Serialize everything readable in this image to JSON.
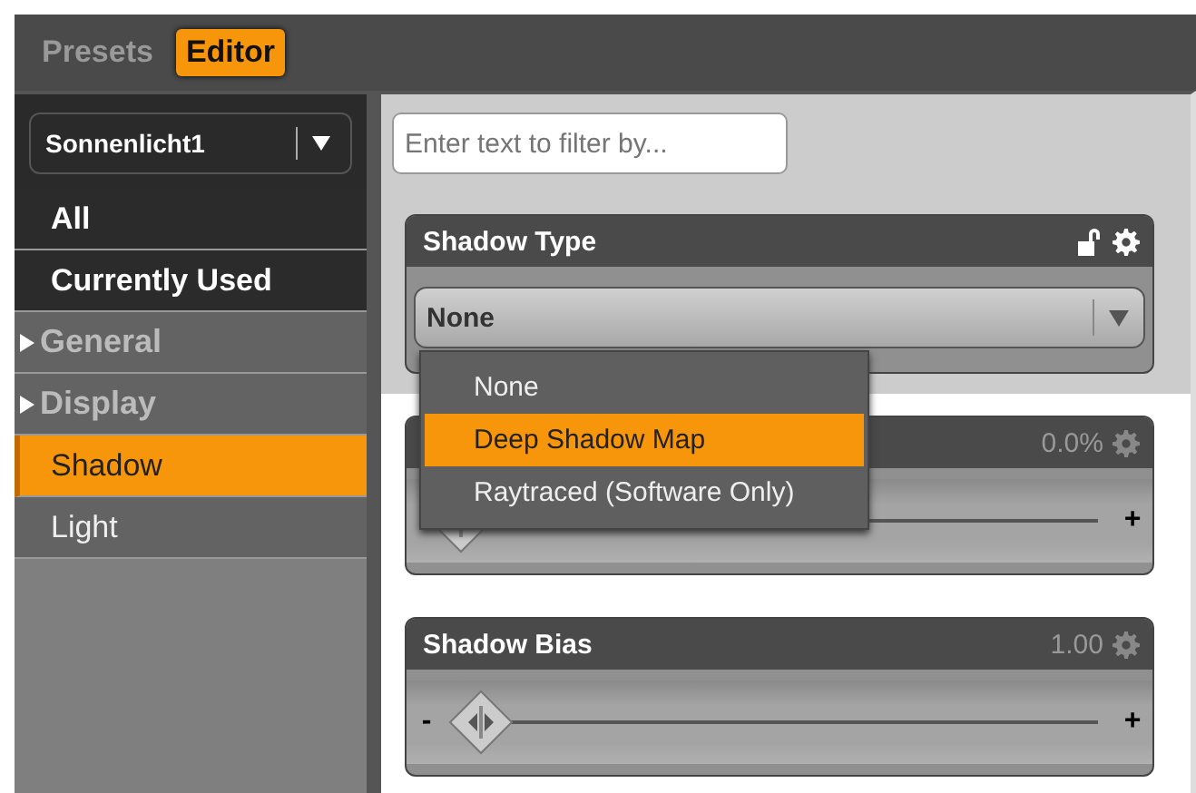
{
  "tabs": [
    {
      "label": "Presets",
      "selected": false
    },
    {
      "label": "Editor",
      "selected": true
    }
  ],
  "node_selector": {
    "value": "Sonnenlicht1"
  },
  "sidebar": {
    "items": [
      {
        "label": "All",
        "kind": "header",
        "selected": false
      },
      {
        "label": "Currently Used",
        "kind": "header",
        "selected": false
      },
      {
        "label": "General",
        "kind": "group",
        "expanded": false,
        "selected": false
      },
      {
        "label": "Display",
        "kind": "group",
        "expanded": false,
        "selected": false
      },
      {
        "label": "Shadow",
        "kind": "item",
        "selected": true
      },
      {
        "label": "Light",
        "kind": "item",
        "selected": false
      }
    ]
  },
  "filter": {
    "placeholder": "Enter text to filter by..."
  },
  "properties": [
    {
      "kind": "list",
      "title": "Shadow Type",
      "value": "None"
    },
    {
      "kind": "slider",
      "reading": "0.0%",
      "plus": "+"
    },
    {
      "kind": "slider",
      "title": "Shadow Bias",
      "reading": "1.00",
      "level": 0.03,
      "minus": "-",
      "plus": "+"
    }
  ],
  "dropdown_menu": {
    "options": [
      {
        "label": "None",
        "selected": false
      },
      {
        "label": "Deep Shadow Map",
        "selected": true
      },
      {
        "label": "Raytraced (Software Only)",
        "selected": false
      }
    ]
  }
}
